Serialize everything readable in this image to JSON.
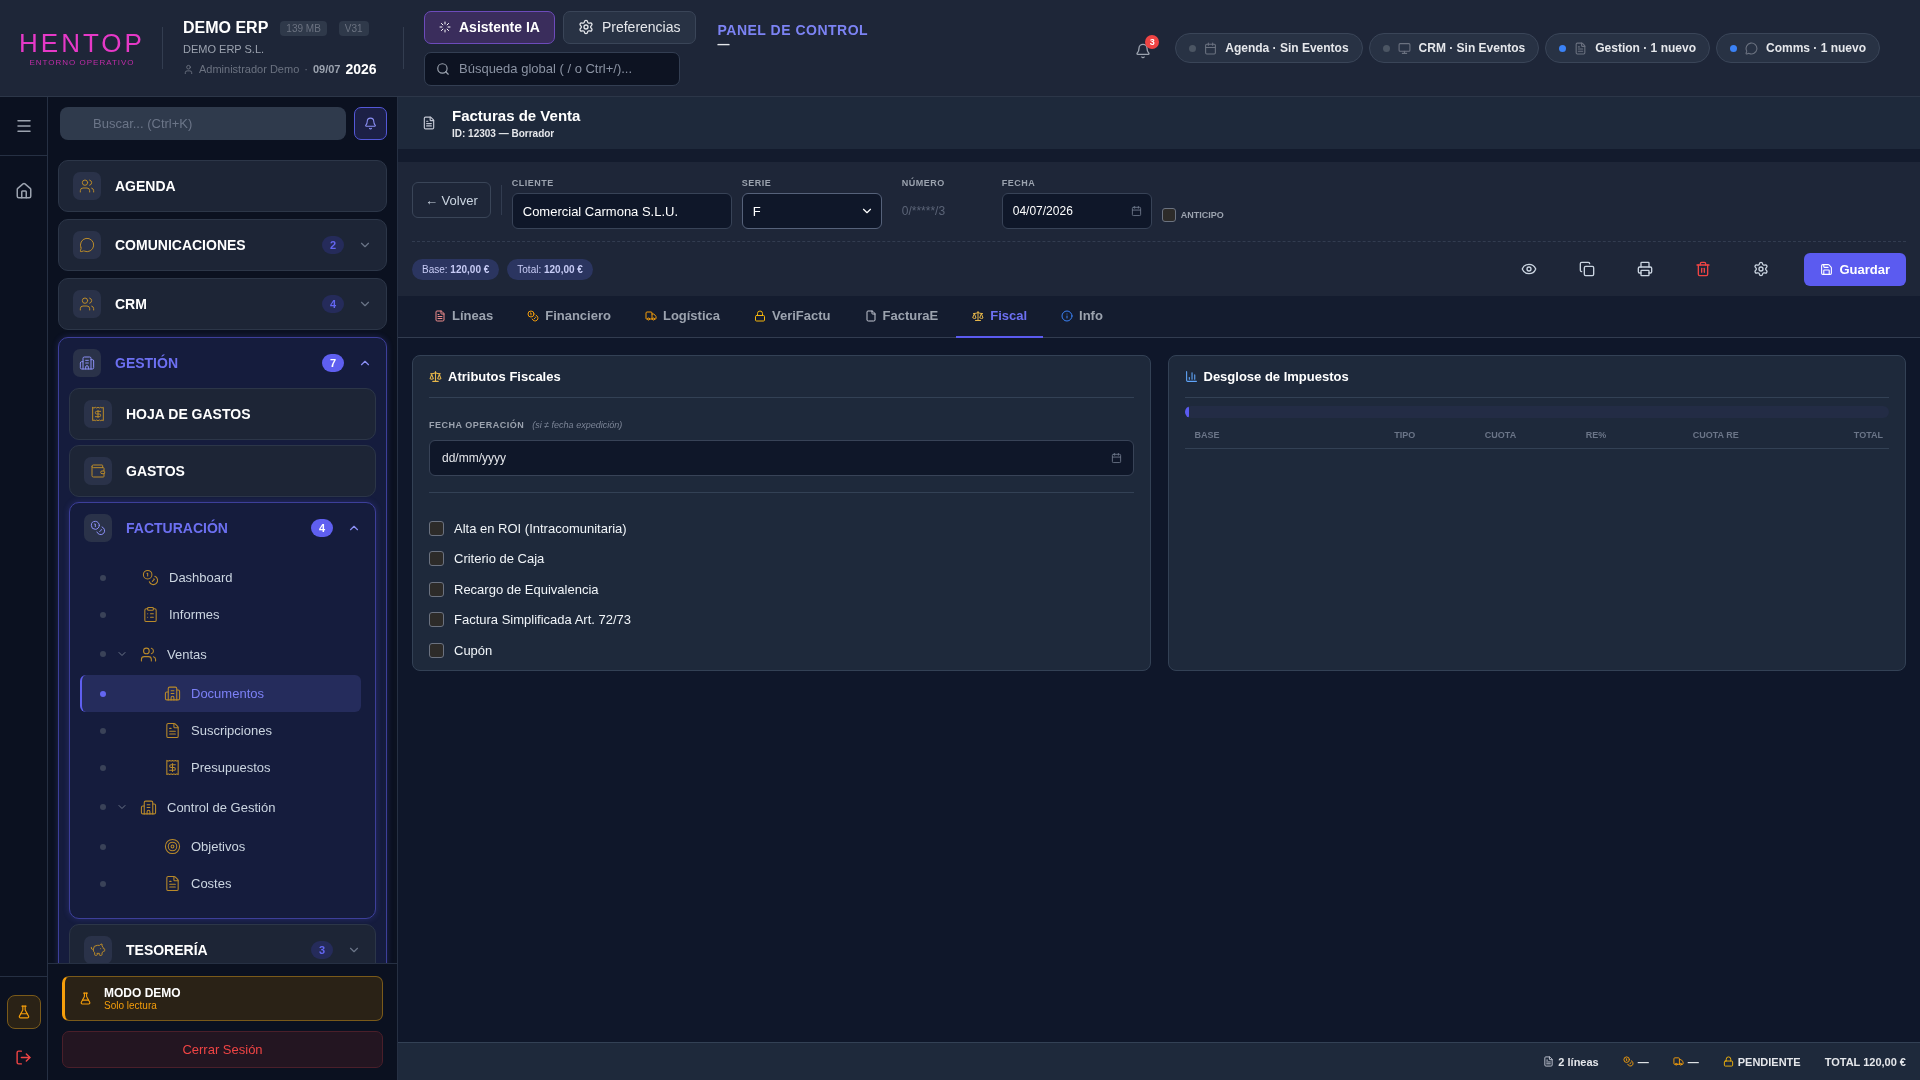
{
  "brand": {
    "logo": "HENTOP",
    "tagline": "ENTORNO OPERATIVO"
  },
  "app": {
    "name": "DEMO ERP",
    "memory": "139 MB",
    "version": "V31",
    "company": "DEMO ERP S.L.",
    "user": "Administrador Demo",
    "separator": "·",
    "date": "09/07",
    "year": "2026"
  },
  "top_buttons": [
    {
      "label": "Asistente IA",
      "kind": "assistant"
    },
    {
      "label": "Preferencias",
      "kind": "settings"
    }
  ],
  "global_search": {
    "placeholder": "Búsqueda global ( / o Ctrl+/)..."
  },
  "panel_link": {
    "label": "PANEL DE CONTROL",
    "underline": "—"
  },
  "notifications": {
    "count": "3"
  },
  "status_pills": [
    {
      "label": "Agenda · Sin Eventos",
      "kind": "calendar",
      "color": "#4b5563"
    },
    {
      "label": "CRM · Sin Eventos",
      "kind": "screen",
      "color": "#4b5563"
    },
    {
      "label": "Gestion · 1 nuevo",
      "kind": "document",
      "color": "#3b82f6"
    },
    {
      "label": "Comms · 1 nuevo",
      "kind": "chat",
      "color": "#3b82f6"
    }
  ],
  "sidebar": {
    "search": {
      "placeholder": "Buscar... (Ctrl+K)"
    },
    "items": [
      {
        "label": "AGENDA",
        "active": false
      },
      {
        "label": "COMUNICACIONES",
        "badge": "2",
        "expanded": false,
        "active": false
      },
      {
        "label": "CRM",
        "badge": "4",
        "expanded": false,
        "active": false
      },
      {
        "label": "GESTIÓN",
        "badge": "7",
        "expanded": true,
        "active": true,
        "children": [
          {
            "label": "HOJA DE GASTOS",
            "active": false
          },
          {
            "label": "GASTOS",
            "active": false
          },
          {
            "label": "FACTURACIÓN",
            "badge": "4",
            "expanded": true,
            "active": true,
            "children": [
              {
                "label": "Dashboard",
                "selected": false
              },
              {
                "label": "Informes",
                "selected": false
              },
              {
                "label": "Ventas",
                "expanded": true,
                "selected": false,
                "children": [
                  {
                    "label": "Documentos",
                    "selected": true
                  },
                  {
                    "label": "Suscripciones",
                    "selected": false
                  },
                  {
                    "label": "Presupuestos",
                    "selected": false
                  }
                ]
              },
              {
                "label": "Control de Gestión",
                "expanded": true,
                "selected": false,
                "children": [
                  {
                    "label": "Objetivos",
                    "selected": false
                  },
                  {
                    "label": "Costes",
                    "selected": false
                  }
                ]
              }
            ]
          },
          {
            "label": "TESORERÍA",
            "badge": "3",
            "expanded": false,
            "active": false
          }
        ]
      }
    ],
    "demo_notice": {
      "title": "MODO DEMO",
      "subtitle": "Solo lectura"
    },
    "logout": "Cerrar Sesión"
  },
  "page": {
    "title": "Facturas de Venta",
    "subtitle": "ID: 12303 — Borrador"
  },
  "back_button": "← Volver",
  "form_fields": [
    {
      "kind": "text",
      "label": "CLIENTE",
      "value": "Comercial Carmona S.L.U."
    },
    {
      "kind": "select",
      "label": "SERIE",
      "value": "F"
    },
    {
      "kind": "readonly",
      "label": "NÚMERO",
      "value": "0/*****/3"
    },
    {
      "kind": "date",
      "label": "FECHA",
      "value": "04/07/2026"
    },
    {
      "kind": "checkbox",
      "label": "ANTICIPO",
      "checked": false
    }
  ],
  "totals": [
    "Base: **120,00 €**",
    "Total: **120,00 €**"
  ],
  "save_button": "Guardar",
  "tabs": [
    {
      "label": "Líneas",
      "selected": false
    },
    {
      "label": "Financiero",
      "selected": false
    },
    {
      "label": "Logística",
      "selected": false
    },
    {
      "label": "VeriFactu",
      "selected": false
    },
    {
      "label": "FacturaE",
      "selected": false
    },
    {
      "label": "Fiscal",
      "selected": true
    },
    {
      "label": "Info",
      "selected": false
    }
  ],
  "fiscal_panel": {
    "title": "Atributos Fiscales",
    "field_label": "FECHA OPERACIÓN",
    "field_hint": "(si ≠ fecha expedición)",
    "placeholder": "dd/mm/yyyy",
    "options": [
      {
        "label": "Alta en ROI (Intracomunitaria)",
        "checked": false
      },
      {
        "label": "Criterio de Caja",
        "checked": false
      },
      {
        "label": "Recargo de Equivalencia",
        "checked": false
      },
      {
        "label": "Factura Simplificada Art. 72/73",
        "checked": false
      },
      {
        "label": "Cupón",
        "checked": false
      }
    ]
  },
  "tax_panel": {
    "title": "Desglose de Impuestos",
    "progress": {
      "level": 0.005
    },
    "columns": [
      "BASE",
      "TIPO",
      "CUOTA",
      "RE%",
      "CUOTA RE",
      "TOTAL"
    ]
  },
  "status_bar": [
    {
      "kind": "lines",
      "label": "2 líneas"
    },
    {
      "kind": "money",
      "label": "—"
    },
    {
      "kind": "shipping",
      "label": "—"
    },
    {
      "kind": "lock",
      "label": "PENDIENTE"
    },
    {
      "kind": "total",
      "label": "TOTAL 120,00 €"
    }
  ]
}
